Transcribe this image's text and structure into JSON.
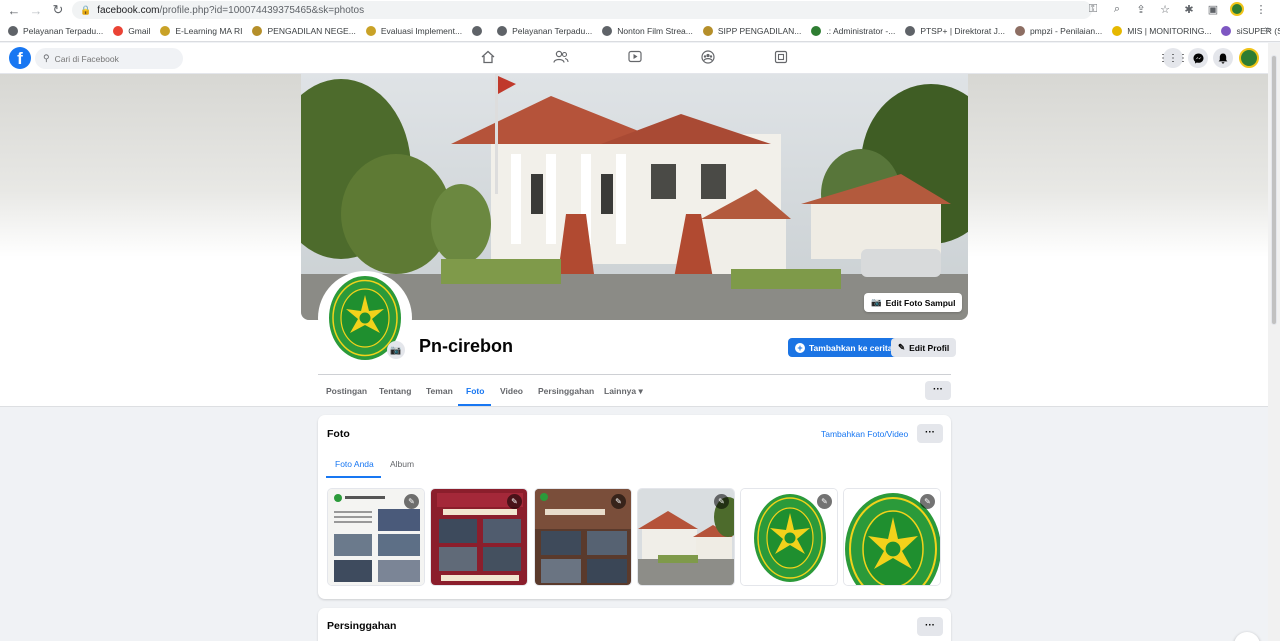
{
  "browser": {
    "url_host": "facebook.com",
    "url_path": "/profile.php?id=100074439375465&sk=photos",
    "bookmarks": [
      {
        "label": "Pelayanan Terpadu...",
        "color": "#5f6368"
      },
      {
        "label": "Gmail",
        "color": "#ea4335"
      },
      {
        "label": "E-Learning MA RI",
        "color": "#c9a227"
      },
      {
        "label": "PENGADILAN NEGE...",
        "color": "#b58f2a"
      },
      {
        "label": "Evaluasi Implement...",
        "color": "#c9a227"
      },
      {
        "label": "",
        "color": "#5f6368"
      },
      {
        "label": "Pelayanan Terpadu...",
        "color": "#5f6368"
      },
      {
        "label": "Nonton Film Strea...",
        "color": "#5f6368"
      },
      {
        "label": "SIPP PENGADILAN...",
        "color": "#b58f2a"
      },
      {
        "label": ".: Administrator -...",
        "color": "#2e7d32"
      },
      {
        "label": "PTSP+ | Direktorat J...",
        "color": "#5f6368"
      },
      {
        "label": "pmpzi - Penilaian...",
        "color": "#8d6e63"
      },
      {
        "label": "MIS | MONITORING...",
        "color": "#e6b800"
      },
      {
        "label": "siSUPER (SPAK, SK...",
        "color": "#7e57c2"
      }
    ]
  },
  "fb": {
    "search_placeholder": "Cari di Facebook"
  },
  "profile": {
    "name": "Pn-cirebon",
    "edit_cover_label": "Edit Foto Sampul",
    "add_story_label": "Tambahkan ke cerita",
    "edit_profile_label": "Edit Profil",
    "tabs": [
      "Postingan",
      "Tentang",
      "Teman",
      "Foto",
      "Video",
      "Persinggahan",
      "Lainnya ▾"
    ],
    "active_tab": "Foto"
  },
  "photos_card": {
    "title": "Foto",
    "add_link": "Tambahkan Foto/Video",
    "subtabs": [
      "Foto Anda",
      "Album"
    ]
  },
  "check_in_card": {
    "title": "Persinggahan"
  },
  "colors": {
    "fb_blue": "#1877f2",
    "emblem_green": "#1f8f2f",
    "emblem_yellow": "#f2d21b"
  }
}
